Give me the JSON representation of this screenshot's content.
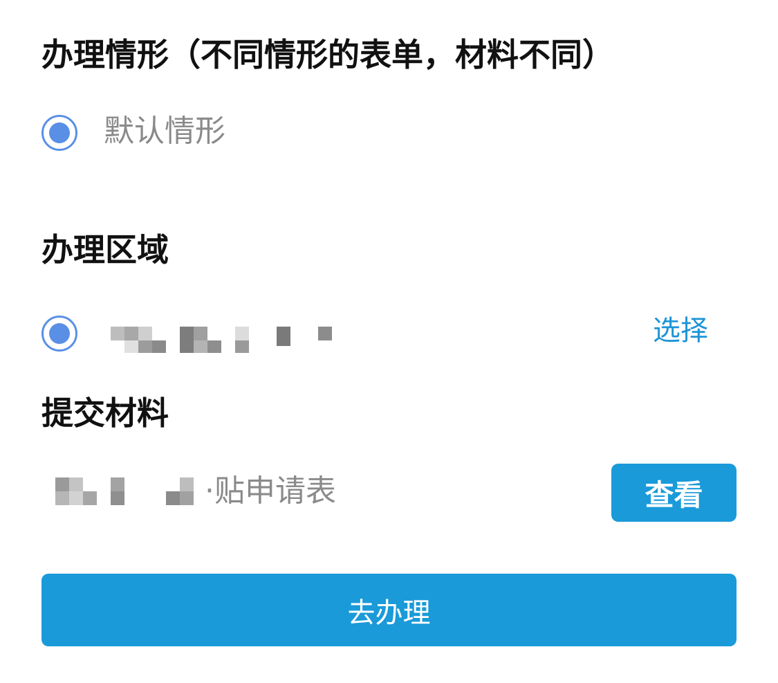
{
  "scenario": {
    "title": "办理情形（不同情形的表单，材料不同）",
    "options": [
      {
        "label": "默认情形",
        "selected": true
      }
    ]
  },
  "region": {
    "title": "办理区域",
    "selected": true,
    "select_label": "选择"
  },
  "materials": {
    "title": "提交材料",
    "items": [
      {
        "name_suffix": "·贴申请表",
        "view_label": "查看"
      }
    ]
  },
  "actions": {
    "submit_label": "去办理"
  },
  "colors": {
    "accent": "#1a9ad9",
    "radio": "#5a8fe6",
    "muted_text": "#8a8a8a",
    "link": "#1e94d6"
  }
}
